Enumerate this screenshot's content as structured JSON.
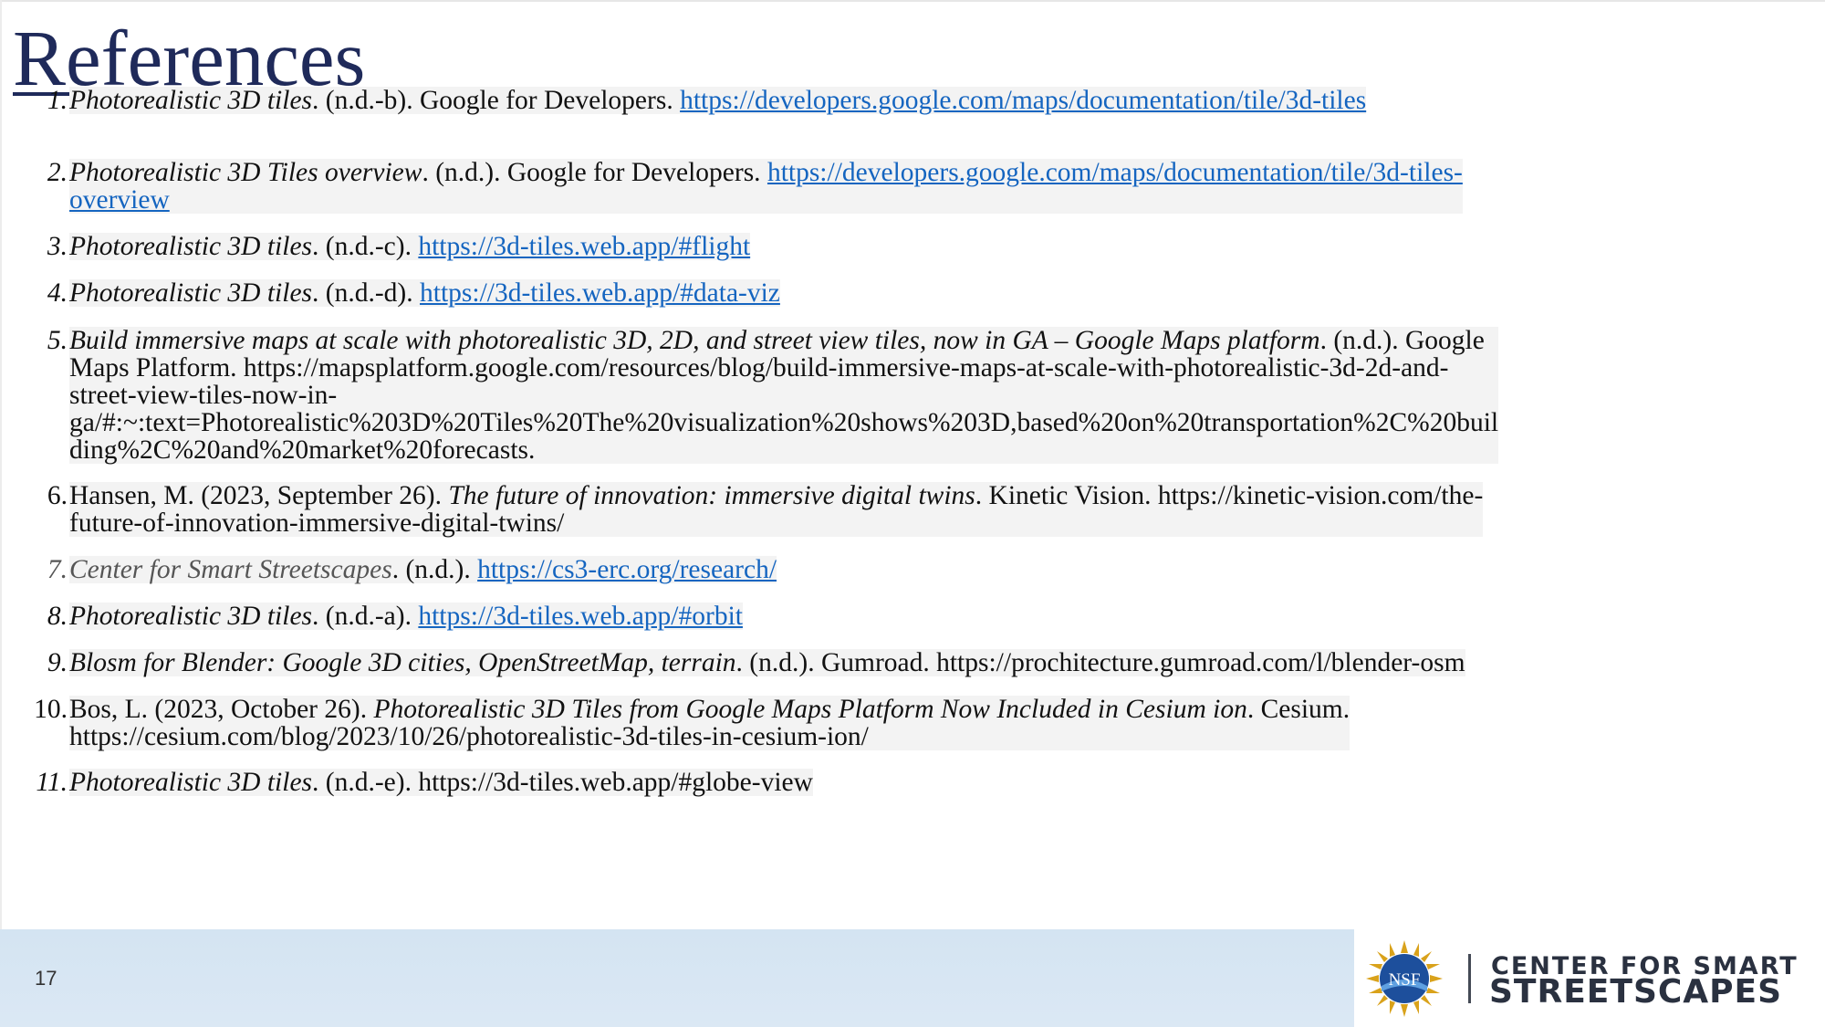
{
  "title": "References",
  "page_number": "17",
  "logo": {
    "nsf_text": "NSF",
    "org_line1": "CENTER FOR SMART",
    "org_line2": "STREETSCAPES"
  },
  "colors": {
    "title": "#1f2a5a",
    "link": "#1565c0",
    "footer": "#d4e4f2"
  },
  "references": [
    {
      "num": "1.",
      "title": "Photorealistic 3D tiles",
      "tail": ". (n.d.-b). Google for Developers. ",
      "link": "https://developers.google.com/maps/documentation/tile/3d-tiles"
    },
    {
      "num": "2.",
      "title": "Photorealistic 3D Tiles overview",
      "tail": ". (n.d.). Google for Developers. ",
      "link1": "https://developers.google.com/maps/documentation/tile/3d-tiles-",
      "link2": "overview"
    },
    {
      "num": "3.",
      "title": "Photorealistic 3D tiles",
      "tail": ". (n.d.-c). ",
      "link": "https://3d-tiles.web.app/#flight"
    },
    {
      "num": "4.",
      "title": "Photorealistic 3D tiles",
      "tail": ". (n.d.-d). ",
      "link": "https://3d-tiles.web.app/#data-viz"
    },
    {
      "num": "5.",
      "title": "Build immersive maps at scale with photorealistic 3D, 2D, and street view tiles, now in GA – Google Maps platform",
      "tail": ". (n.d.). Google",
      "line2": "Maps Platform. https://mapsplatform.google.com/resources/blog/build-immersive-maps-at-scale-with-photorealistic-3d-2d-and-",
      "line3": "street-view-tiles-now-in-",
      "line4": "ga/#:~:text=Photorealistic%203D%20Tiles%20The%20visualization%20shows%203D,based%20on%20transportation%2C%20buil",
      "line5": "ding%2C%20and%20market%20forecasts."
    },
    {
      "num": "6.",
      "lead": "Hansen, M. (2023, September 26). ",
      "title": "The future of innovation: immersive digital twins",
      "tail": ". Kinetic Vision. https://kinetic-vision.com/the-",
      "line2": "future-of-innovation-immersive-digital-twins/"
    },
    {
      "num": "7.",
      "title": "Center for Smart Streetscapes",
      "tail": ". (n.d.). ",
      "link": "https://cs3-erc.org/research/"
    },
    {
      "num": "8.",
      "title": "Photorealistic 3D tiles",
      "tail": ". (n.d.-a). ",
      "link": "https://3d-tiles.web.app/#orbit"
    },
    {
      "num": "9.",
      "title": "Blosm for Blender: Google 3D cities, OpenStreetMap, terrain",
      "tail": ". (n.d.). Gumroad. https://prochitecture.gumroad.com/l/blender-osm"
    },
    {
      "num": "10.",
      "lead": "Bos, L. (2023, October 26). ",
      "title": "Photorealistic 3D Tiles from Google Maps Platform Now Included in Cesium ion",
      "tail": ". Cesium.",
      "line2": "https://cesium.com/blog/2023/10/26/photorealistic-3d-tiles-in-cesium-ion/"
    },
    {
      "num": "11.",
      "title": "Photorealistic 3D tiles",
      "tail": ". (n.d.-e). https://3d-tiles.web.app/#globe-view"
    }
  ]
}
